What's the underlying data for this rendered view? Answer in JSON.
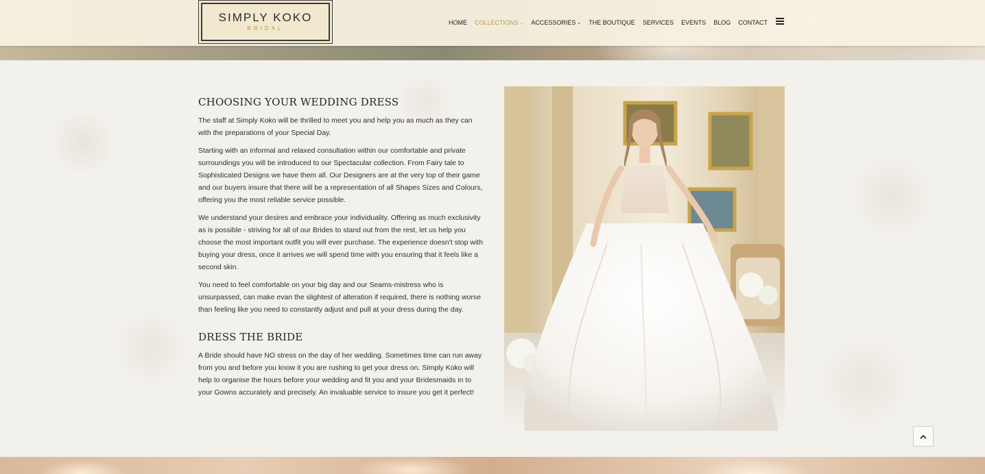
{
  "brand": {
    "name": "SIMPLY KOKO",
    "tagline": "BRIDAL"
  },
  "nav": {
    "items": [
      {
        "label": "HOME",
        "active": false,
        "has_dropdown": false
      },
      {
        "label": "COLLECTIONS",
        "active": true,
        "has_dropdown": true
      },
      {
        "label": "ACCESSORIES",
        "active": false,
        "has_dropdown": true
      },
      {
        "label": "THE BOUTIQUE",
        "active": false,
        "has_dropdown": false
      },
      {
        "label": "SERVICES",
        "active": false,
        "has_dropdown": false
      },
      {
        "label": "EVENTS",
        "active": false,
        "has_dropdown": false
      },
      {
        "label": "BLOG",
        "active": false,
        "has_dropdown": false
      },
      {
        "label": "CONTACT",
        "active": false,
        "has_dropdown": false
      }
    ],
    "menu_icon": "hamburger-icon"
  },
  "main": {
    "sections": [
      {
        "heading": "CHOOSING YOUR WEDDING DRESS",
        "paragraphs": [
          "The staff at Simply Koko will be thrilled to meet you and help you as much as they can with the preparations of your Special Day.",
          "Starting with an informal and relaxed consultation within our comfortable and private surroundings you will be introduced to our Spectacular collection.  From Fairy tale to Sophisticated Designs we have them all.  Our Designers are at the very top of their game and our buyers insure that there will be a representation of all Shapes Sizes and Colours, offering you the most reliable service possible.",
          "We understand your desires and embrace your individuality.  Offering as much exclusivity as is possible - striving for all of our Brides to stand out from the rest, let us help you choose the most important outfit you will ever purchase. The experience doesn't stop with buying your dress, once it arrives we will spend time with you ensuring that it feels like a second skin.",
          "You need to feel comfortable on your big day and our Seams-mistress who is unsurpassed, can make evan the slightest of alteration if required, there is nothing worse than feeling like you need to constantly adjust and pull at your dress during the day."
        ]
      },
      {
        "heading": "DRESS THE BRIDE",
        "paragraphs": [
          "A Bride should have NO stress on the day of her wedding.  Sometimes time can run away from you and before you know it you are rushing to get your dress on.  Simply Koko will help to organise the hours before your wedding and fit you and your Bridesmaids in to your Gowns accurately and precisely.  An invaluable service to insure you get it perfect!"
        ]
      }
    ]
  },
  "scroll_top": {
    "icon": "chevron-up-icon"
  },
  "colors": {
    "accent": "#b59b52",
    "text": "#2a2a2a",
    "header_bg": "#f7f2e2",
    "content_bg": "#f3f1ec"
  }
}
